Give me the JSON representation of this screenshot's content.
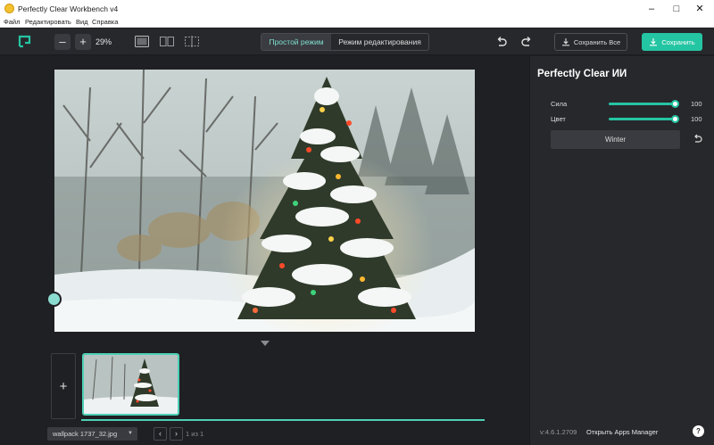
{
  "window": {
    "title": "Perfectly Clear Workbench v4"
  },
  "menu": [
    "Файл",
    "Редактировать",
    "Вид",
    "Справка"
  ],
  "toolbar": {
    "zoom": "29%",
    "mode_simple": "Простой режим",
    "mode_edit": "Режим редактирования",
    "save_all": "Сохранить Все",
    "save": "Сохранить"
  },
  "filmstrip": {
    "add": "+",
    "file_name": "wallpack 1737_32.jpg",
    "page_count": "1 из 1"
  },
  "panel": {
    "title": "Perfectly Clear ИИ",
    "sliders": [
      {
        "label": "Сила",
        "value": "100"
      },
      {
        "label": "Цвет",
        "value": "100"
      }
    ],
    "preset": "Winter",
    "version": "v:4.6.1.2709",
    "apps_manager": "Открыть Apps Manager",
    "help": "?"
  },
  "colors": {
    "accent": "#24c5a2",
    "bg": "#1f2024",
    "panel": "#27282c"
  }
}
